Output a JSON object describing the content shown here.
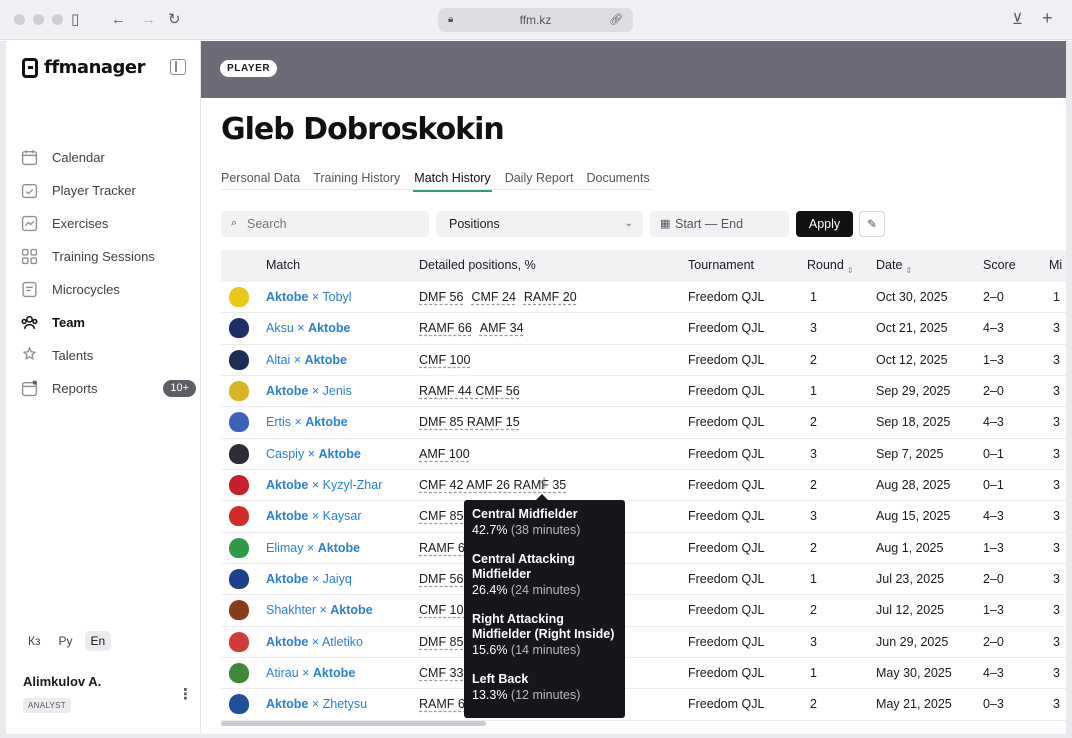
{
  "browser": {
    "url": "ffm.kz"
  },
  "app": {
    "logo": "ffmanager"
  },
  "sidebar": {
    "items": [
      {
        "label": "Calendar",
        "icon": "calendar-icon"
      },
      {
        "label": "Player Tracker",
        "icon": "tracker-icon"
      },
      {
        "label": "Exercises",
        "icon": "exercises-icon"
      },
      {
        "label": "Training Sessions",
        "icon": "sessions-icon"
      },
      {
        "label": "Microcycles",
        "icon": "microcycles-icon"
      },
      {
        "label": "Team",
        "icon": "team-icon",
        "active": true
      },
      {
        "label": "Talents",
        "icon": "talents-icon"
      },
      {
        "label": "Reports",
        "icon": "reports-icon",
        "badge": "10+"
      }
    ],
    "languages": [
      "Кз",
      "Ру",
      "En"
    ],
    "active_language": "En",
    "user": {
      "name": "Alimkulov A.",
      "role": "ANALYST"
    }
  },
  "page": {
    "type_pill": "PLAYER",
    "title": "Gleb Dobroskokin",
    "tabs": [
      "Personal Data",
      "Training History",
      "Match History",
      "Daily Report",
      "Documents"
    ],
    "active_tab": "Match History"
  },
  "filters": {
    "search_placeholder": "Search",
    "positions_label": "Positions",
    "date_placeholder": "Start — End",
    "apply_label": "Apply"
  },
  "table": {
    "headers": [
      "Match",
      "Detailed positions, %",
      "Tournament",
      "Round",
      "Date",
      "Score",
      "Mi"
    ],
    "rows": [
      {
        "home": "Aktobe",
        "away": "Tobyl",
        "aktobe_first": true,
        "positions": [
          "DMF 56",
          "CMF 24",
          "RAMF 20"
        ],
        "tournament": "Freedom QJL",
        "round": "1",
        "date": "Oct 30, 2025",
        "score": "2–0",
        "mins": "1",
        "crest": "#e8c916"
      },
      {
        "home": "Aksu",
        "away": "Aktobe",
        "aktobe_first": false,
        "positions": [
          "RAMF 66",
          "AMF 34"
        ],
        "tournament": "Freedom QJL",
        "round": "3",
        "date": "Oct 21, 2025",
        "score": "4–3",
        "mins": "3",
        "crest": "#1d2e6b"
      },
      {
        "home": "Altai",
        "away": "Aktobe",
        "aktobe_first": false,
        "positions": [
          "CMF 100"
        ],
        "tournament": "Freedom QJL",
        "round": "2",
        "date": "Oct 12, 2025",
        "score": "1–3",
        "mins": "3",
        "crest": "#1f2c55"
      },
      {
        "home": "Aktobe",
        "away": "Jenis",
        "aktobe_first": true,
        "positions": [
          "RAMF 44 CMF 56"
        ],
        "tournament": "Freedom QJL",
        "round": "1",
        "date": "Sep 29, 2025",
        "score": "2–0",
        "mins": "3",
        "crest": "#d8b420"
      },
      {
        "home": "Ertis",
        "away": "Aktobe",
        "aktobe_first": false,
        "positions": [
          "DMF 85 RAMF 15"
        ],
        "tournament": "Freedom QJL",
        "round": "2",
        "date": "Sep 18, 2025",
        "score": "4–3",
        "mins": "3",
        "crest": "#3b62b8"
      },
      {
        "home": "Caspiy",
        "away": "Aktobe",
        "aktobe_first": false,
        "positions": [
          "AMF 100"
        ],
        "tournament": "Freedom QJL",
        "round": "3",
        "date": "Sep 7, 2025",
        "score": "0–1",
        "mins": "3",
        "crest": "#2d2d33"
      },
      {
        "home": "Aktobe",
        "away": "Kyzyl-Zhar",
        "aktobe_first": true,
        "positions": [
          "CMF 42 AMF 26 RAMF 35"
        ],
        "tournament": "Freedom QJL",
        "round": "2",
        "date": "Aug 28, 2025",
        "score": "0–1",
        "mins": "3",
        "crest": "#c8202a"
      },
      {
        "home": "Aktobe",
        "away": "Kaysar",
        "aktobe_first": true,
        "positions": [
          "CMF 85"
        ],
        "tournament": "Freedom QJL",
        "round": "3",
        "date": "Aug 15, 2025",
        "score": "4–3",
        "mins": "3",
        "crest": "#d12b2b"
      },
      {
        "home": "Elimay",
        "away": "Aktobe",
        "aktobe_first": false,
        "positions": [
          "RAMF 66"
        ],
        "tournament": "Freedom QJL",
        "round": "2",
        "date": "Aug 1, 2025",
        "score": "1–3",
        "mins": "3",
        "crest": "#2e9b4b"
      },
      {
        "home": "Aktobe",
        "away": "Jaiyq",
        "aktobe_first": true,
        "positions": [
          "DMF 56"
        ],
        "tournament": "Freedom QJL",
        "round": "1",
        "date": "Jul 23, 2025",
        "score": "2–0",
        "mins": "3",
        "crest": "#1c3f8f"
      },
      {
        "home": "Shakhter",
        "away": "Aktobe",
        "aktobe_first": false,
        "positions": [
          "CMF 100"
        ],
        "tournament": "Freedom QJL",
        "round": "2",
        "date": "Jul 12, 2025",
        "score": "1–3",
        "mins": "3",
        "crest": "#8a3b1a"
      },
      {
        "home": "Aktobe",
        "away": "Atletiko",
        "aktobe_first": true,
        "positions": [
          "DMF 85"
        ],
        "tournament": "Freedom QJL",
        "round": "3",
        "date": "Jun 29, 2025",
        "score": "2–0",
        "mins": "3",
        "crest": "#d03a3a"
      },
      {
        "home": "Atirau",
        "away": "Aktobe",
        "aktobe_first": false,
        "positions": [
          "CMF 33"
        ],
        "tournament": "Freedom QJL",
        "round": "1",
        "date": "May 30, 2025",
        "score": "4–3",
        "mins": "3",
        "crest": "#3f8a3a"
      },
      {
        "home": "Aktobe",
        "away": "Zhetysu",
        "aktobe_first": true,
        "positions": [
          "RAMF 66"
        ],
        "tournament": "Freedom QJL",
        "round": "2",
        "date": "May 21, 2025",
        "score": "0–3",
        "mins": "3",
        "crest": "#1d4f9e"
      }
    ]
  },
  "tooltip": [
    {
      "label": "Central Midfielder",
      "pct": "42.7%",
      "mins": "(38 minutes)"
    },
    {
      "label": "Central Attacking Midfielder",
      "pct": "26.4%",
      "mins": "(24 minutes)"
    },
    {
      "label": "Right Attacking Midfielder (Right Inside)",
      "pct": "15.6%",
      "mins": "(14 minutes)"
    },
    {
      "label": "Left Back",
      "pct": "13.3%",
      "mins": "(12 minutes)"
    }
  ]
}
